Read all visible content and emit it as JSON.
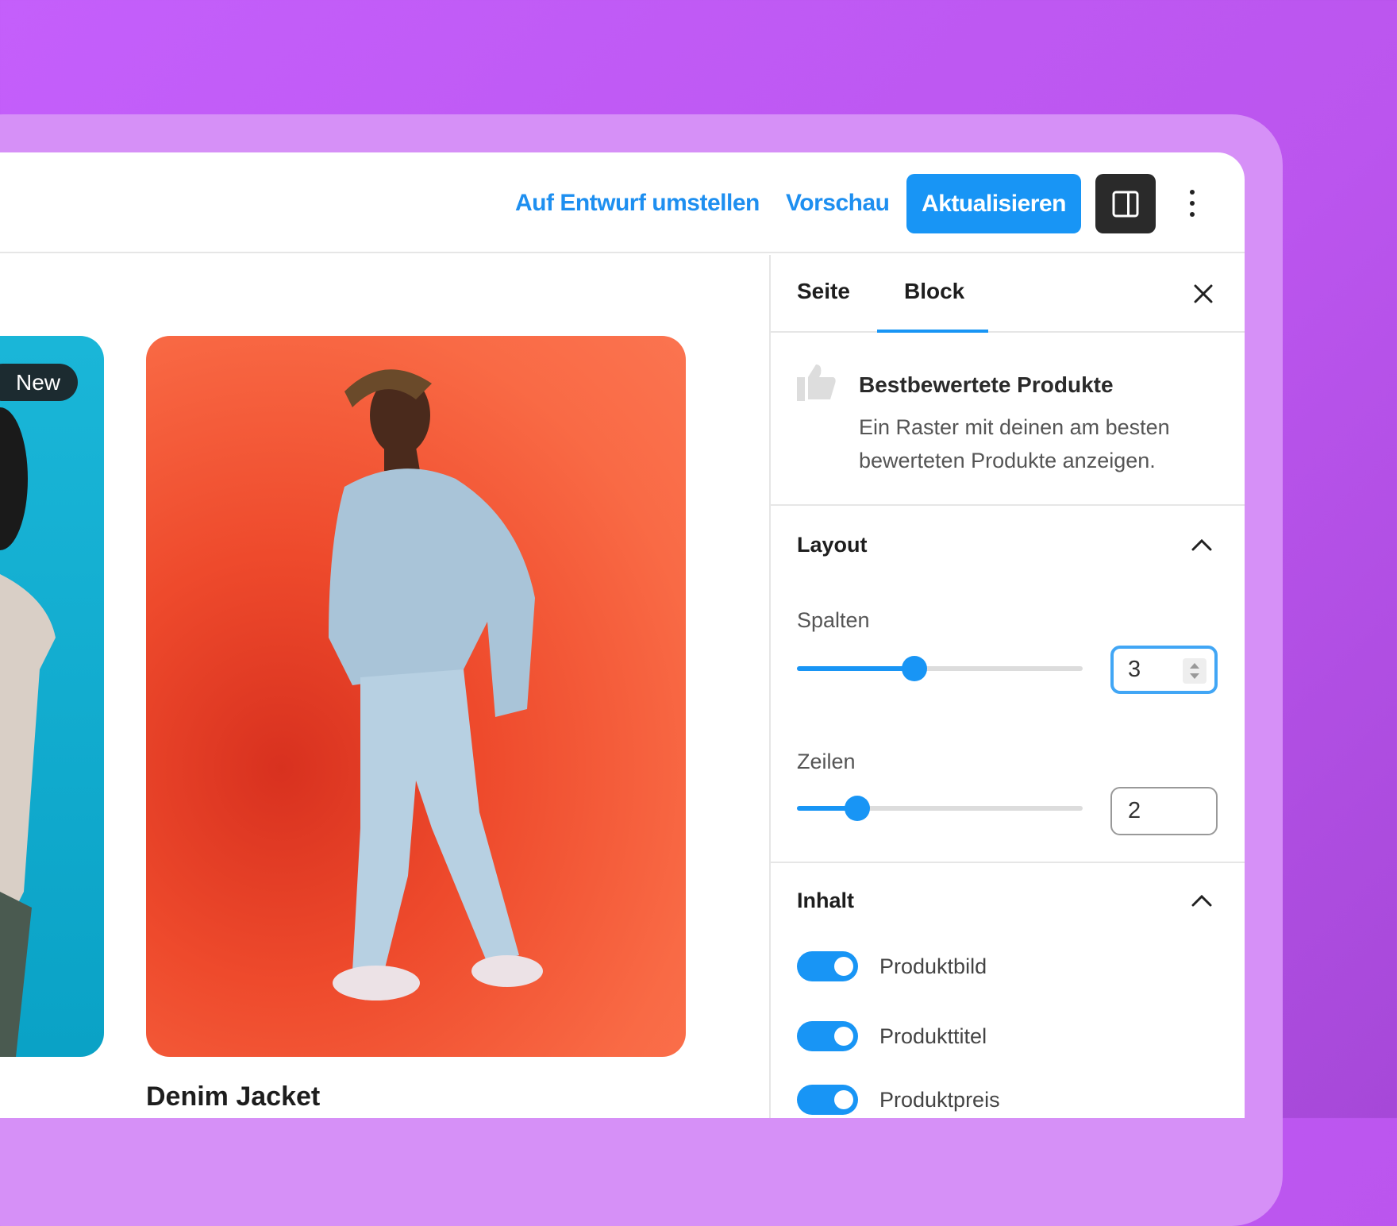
{
  "header": {
    "switch_draft": "Auf Entwurf umstellen",
    "preview": "Vorschau",
    "update": "Aktualisieren"
  },
  "canvas": {
    "badge": "New",
    "product_title": "Denim Jacket"
  },
  "sidebar": {
    "tabs": [
      {
        "label": "Seite"
      },
      {
        "label": "Block",
        "active": true
      }
    ],
    "block": {
      "icon": "thumbs-up-icon",
      "title": "Bestbewertete Produkte",
      "description": "Ein Raster mit deinen am besten bewerteten Produkte anzeigen."
    },
    "layout": {
      "title": "Layout",
      "columns": {
        "label": "Spalten",
        "value": "3",
        "slider_fraction": 0.41
      },
      "rows": {
        "label": "Zeilen",
        "value": "2",
        "slider_fraction": 0.21
      }
    },
    "content": {
      "title": "Inhalt",
      "toggles": [
        {
          "label": "Produktbild",
          "on": true
        },
        {
          "label": "Produkttitel",
          "on": true
        },
        {
          "label": "Produktpreis",
          "on": true
        }
      ]
    }
  },
  "colors": {
    "accent": "#1895f5",
    "background": "#c45ffb"
  }
}
